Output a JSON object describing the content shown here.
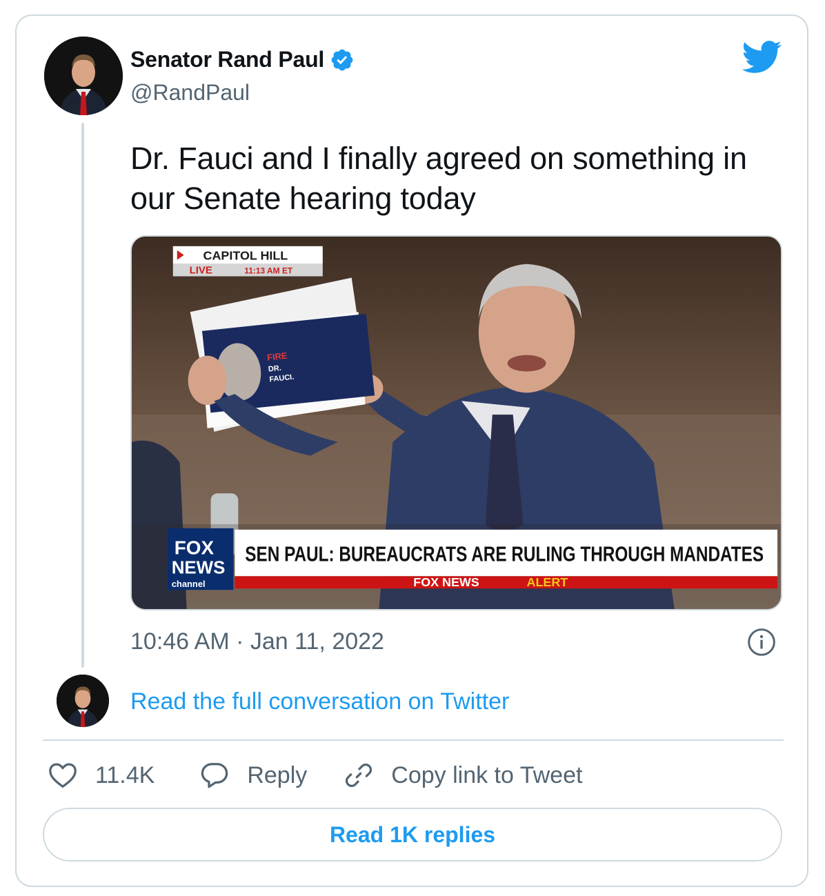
{
  "author": {
    "display_name": "Senator Rand Paul",
    "handle": "@RandPaul",
    "verified": true
  },
  "tweet": {
    "text": "Dr. Fauci and I finally agreed on something in our Senate hearing today",
    "timestamp": "10:46 AM · Jan 11, 2022"
  },
  "media": {
    "location_tag": "CAPITOL HILL",
    "live_label": "LIVE",
    "live_time": "11:13 AM ET",
    "paper_fire": "FIRE",
    "paper_dr": "DR.",
    "paper_fauci": "FAUCI.",
    "network_logo_fox": "FOX",
    "network_logo_news": "NEWS",
    "network_logo_channel": "channel",
    "headline": "SEN PAUL: BUREAUCRATS ARE RULING THROUGH MANDATES",
    "alert_prefix": "FOX NEWS",
    "alert_word": "ALERT"
  },
  "conversation_link": "Read the full conversation on Twitter",
  "actions": {
    "like_count": "11.4K",
    "reply_label": "Reply",
    "copy_label": "Copy link to Tweet"
  },
  "read_replies_label": "Read 1K replies",
  "colors": {
    "twitter_blue": "#1d9bf0",
    "text_primary": "#0f1419",
    "text_secondary": "#536471",
    "border": "#cfd9de"
  }
}
